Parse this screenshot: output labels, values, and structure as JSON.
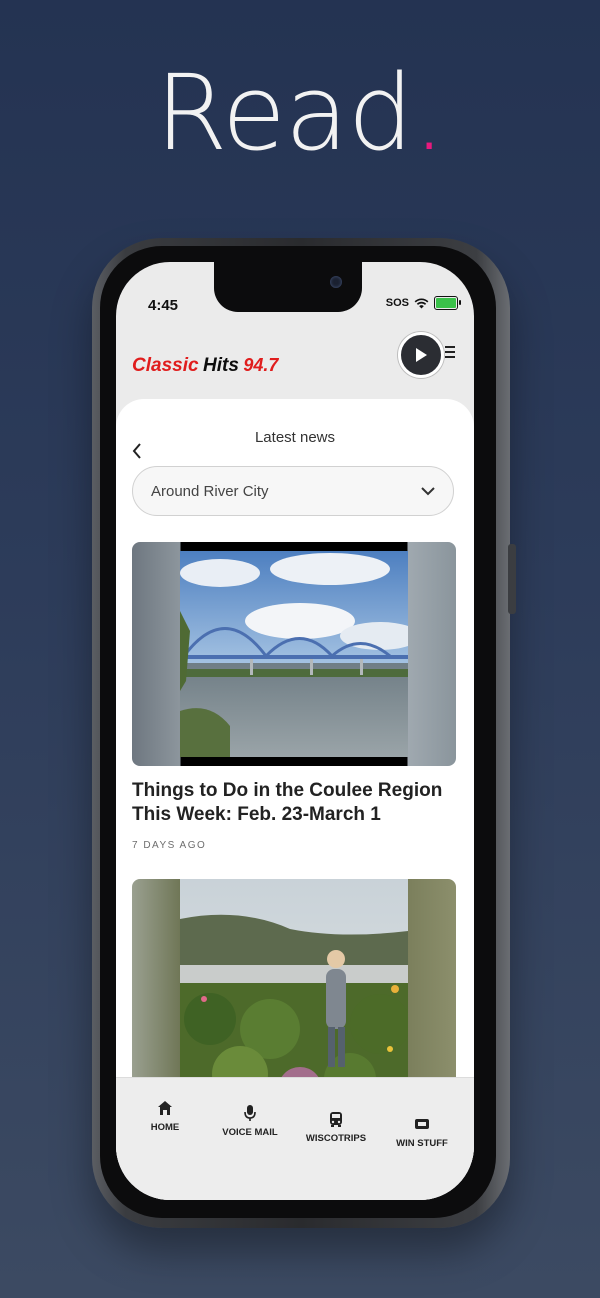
{
  "headline": {
    "word": "Read",
    "accent": "."
  },
  "status_bar": {
    "time": "4:45",
    "sos": "SOS"
  },
  "brand": {
    "part1": "Classic",
    "part2": "Hits",
    "part3": "94.7"
  },
  "header": {
    "title": "Latest news"
  },
  "filter": {
    "selected": "Around River City"
  },
  "articles": [
    {
      "title": "Things to Do in the Coulee Region This Week: Feb. 23-March 1",
      "age": "7 DAYS AGO"
    }
  ],
  "tabs": [
    {
      "label": "HOME",
      "icon": "home-icon"
    },
    {
      "label": "VOICE MAIL",
      "icon": "microphone-icon"
    },
    {
      "label": "WISCOTRIPS",
      "icon": "bus-icon"
    },
    {
      "label": "WIN STUFF",
      "icon": "ticket-icon"
    }
  ],
  "colors": {
    "accent": "#e8197e",
    "brand_red": "#e01d1d",
    "background": "#243352"
  }
}
